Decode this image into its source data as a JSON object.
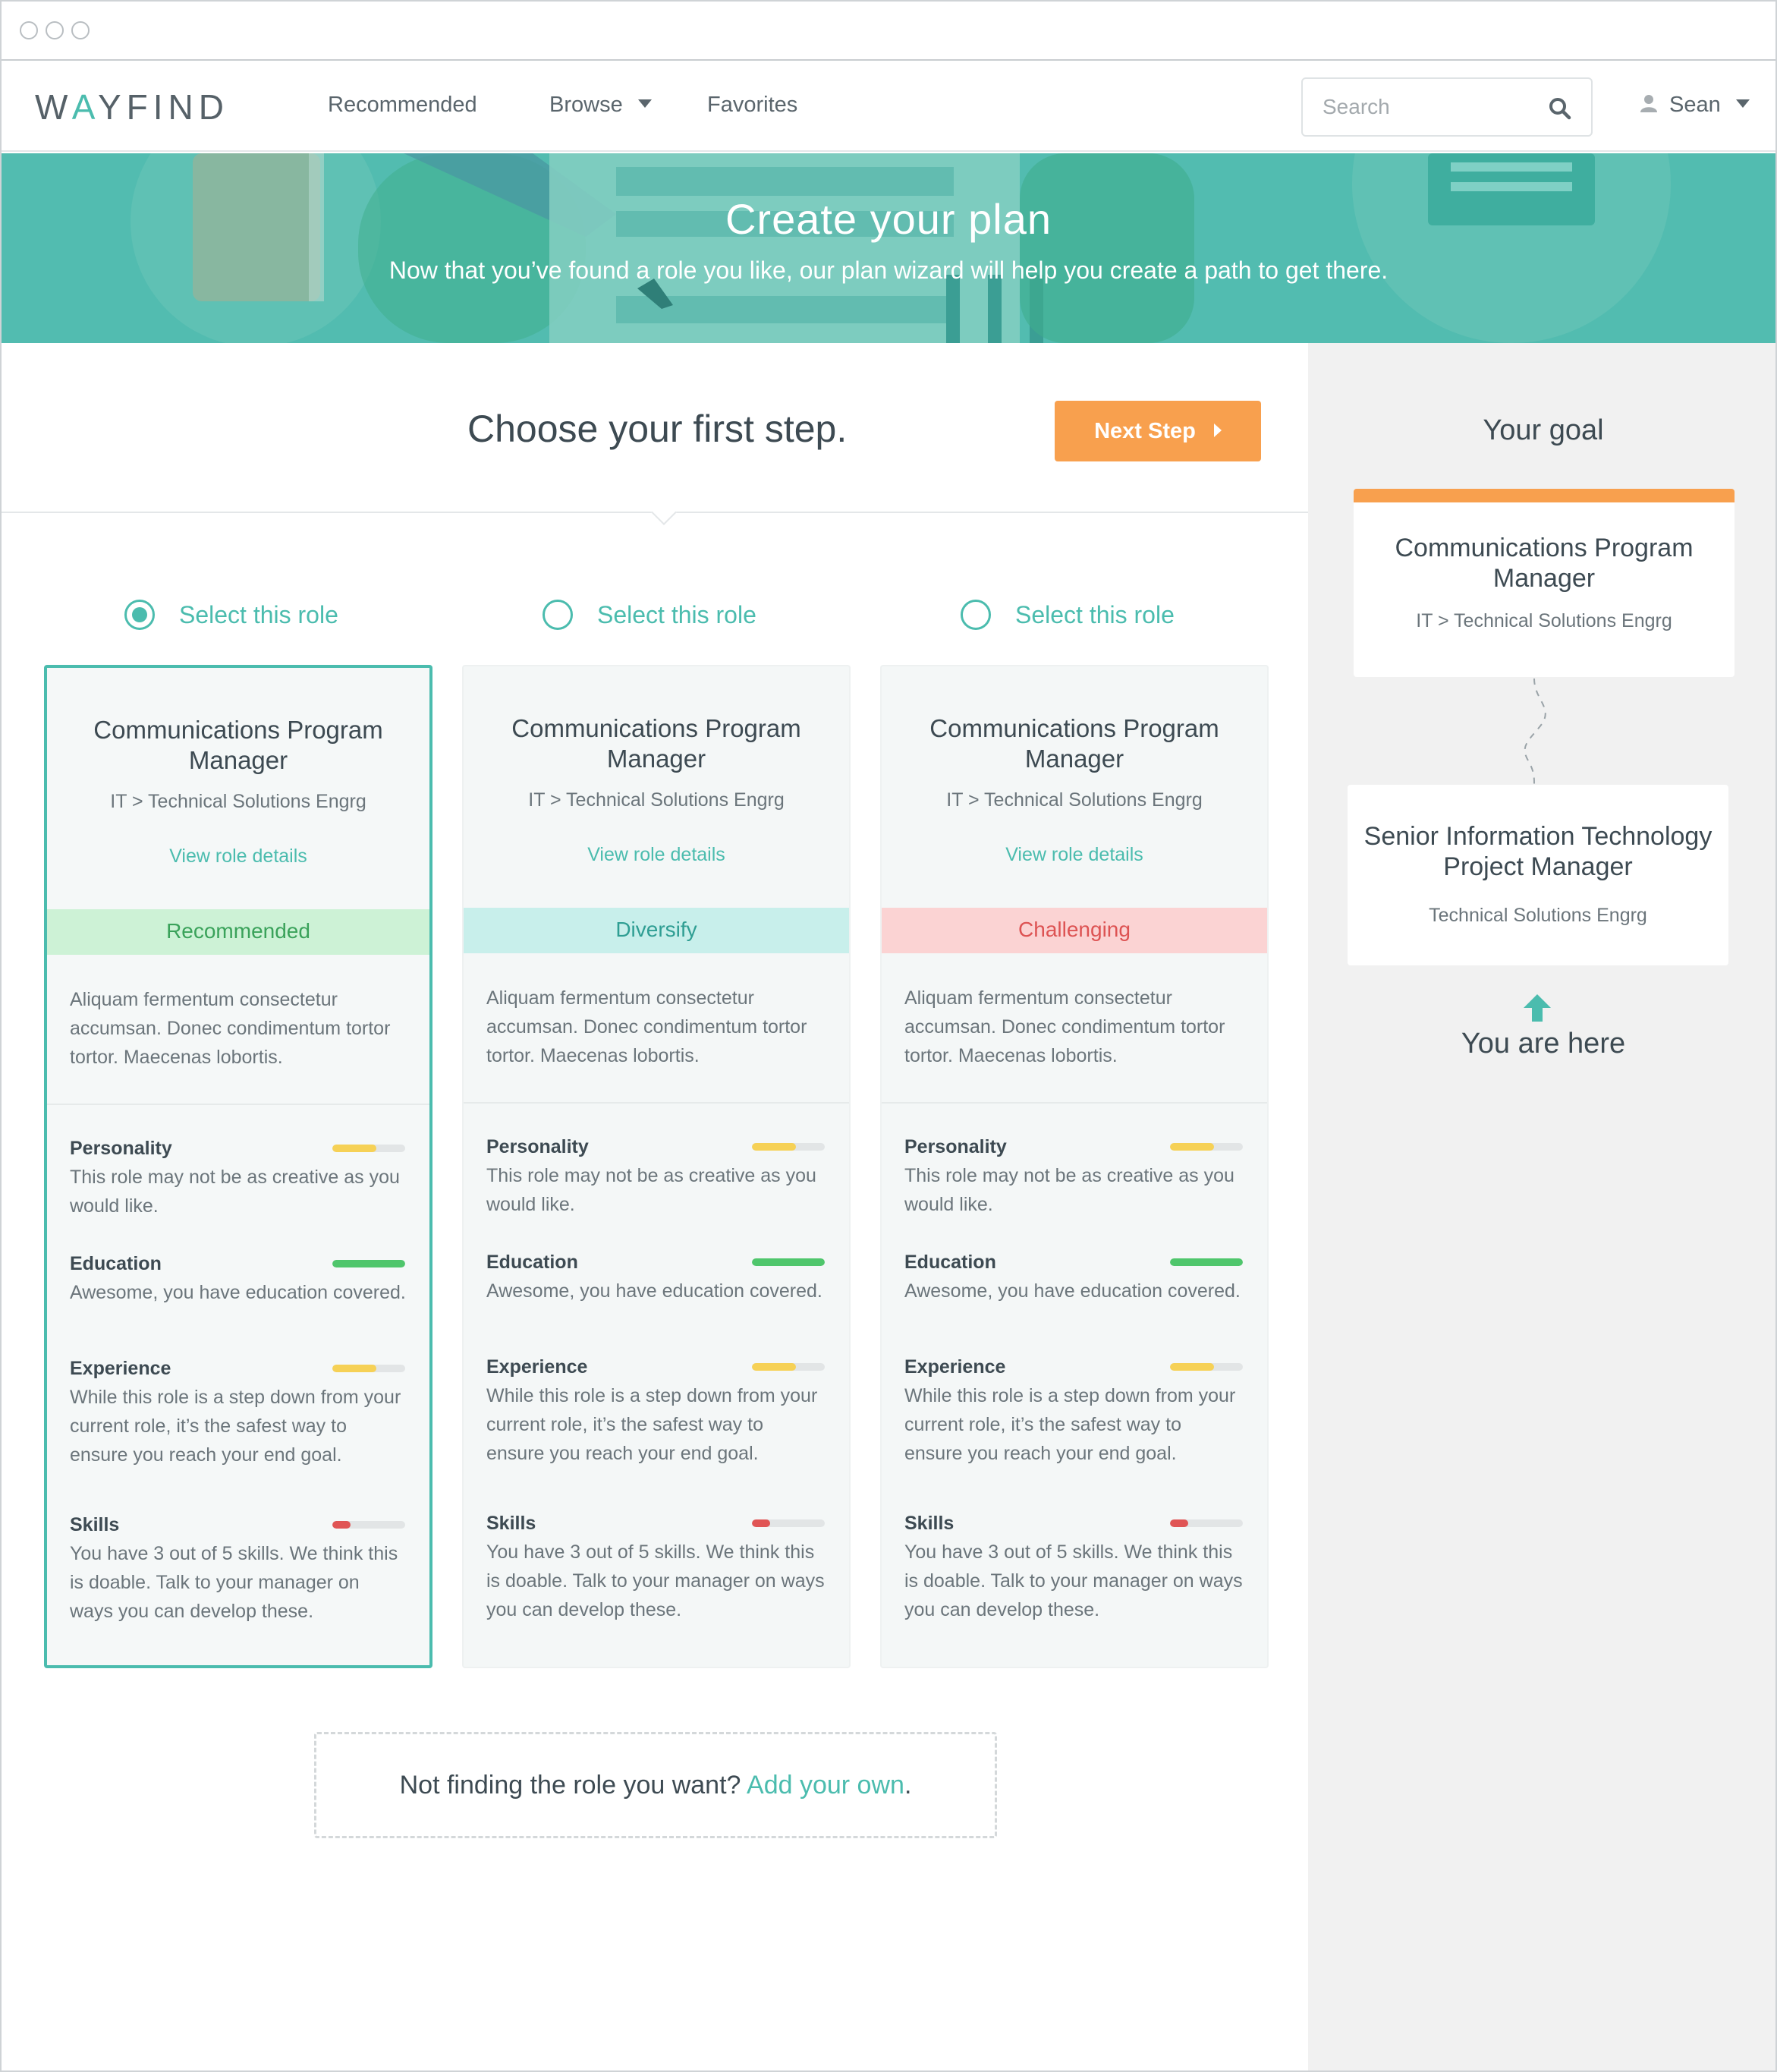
{
  "nav": {
    "logo_prefix": "W",
    "logo_accent": "A",
    "logo_suffix": "YFIND",
    "links": [
      "Recommended",
      "Browse",
      "Favorites"
    ],
    "search_placeholder": "Search",
    "user_name": "Sean"
  },
  "hero": {
    "title": "Create your plan",
    "subtitle": "Now that you’ve found a role you like, our plan wizard will help you create a path to get there."
  },
  "wizard": {
    "step_title": "Choose your first step.",
    "next_button": "Next Step"
  },
  "roles": [
    {
      "select_label": "Select this role",
      "selected": true,
      "title": "Communications Program Manager",
      "path": "IT > Technical Solutions Engrg",
      "details_link": "View role details",
      "tag": "Recommended",
      "description": "Aliquam fermentum consectetur accumsan. Donec condimentum tortor tortor. Maecenas lobortis.",
      "metrics": [
        {
          "name": "Personality",
          "text": "This role may not be as creative as you would like.",
          "level": 0.6,
          "status": "yellow"
        },
        {
          "name": "Education",
          "text": "Awesome, you have education covered.",
          "level": 1.0,
          "status": "green"
        },
        {
          "name": "Experience",
          "text": "While this role is a step down from your current role, it’s the safest way to ensure you reach your end goal.",
          "level": 0.6,
          "status": "yellow"
        },
        {
          "name": "Skills",
          "text": "You have 3 out of 5 skills. We think this is doable. Talk to your manager on ways you can develop these.",
          "level": 0.25,
          "status": "red"
        }
      ]
    },
    {
      "select_label": "Select this role",
      "selected": false,
      "title": "Communications Program Manager",
      "path": "IT > Technical Solutions Engrg",
      "details_link": "View role details",
      "tag": "Diversify",
      "description": "Aliquam fermentum consectetur accumsan. Donec condimentum tortor tortor. Maecenas lobortis.",
      "metrics": [
        {
          "name": "Personality",
          "text": "This role may not be as creative as you would like.",
          "level": 0.6,
          "status": "yellow"
        },
        {
          "name": "Education",
          "text": "Awesome, you have education covered.",
          "level": 1.0,
          "status": "green"
        },
        {
          "name": "Experience",
          "text": "While this role is a step down from your current role, it’s the safest way to ensure you reach your end goal.",
          "level": 0.6,
          "status": "yellow"
        },
        {
          "name": "Skills",
          "text": "You have 3 out of 5 skills. We think this is doable. Talk to your manager on ways you can develop these.",
          "level": 0.25,
          "status": "red"
        }
      ]
    },
    {
      "select_label": "Select this role",
      "selected": false,
      "title": "Communications Program Manager",
      "path": "IT > Technical Solutions Engrg",
      "details_link": "View role details",
      "tag": "Challenging",
      "description": "Aliquam fermentum consectetur accumsan. Donec condimentum tortor tortor. Maecenas lobortis.",
      "metrics": [
        {
          "name": "Personality",
          "text": "This role may not be as creative as you would like.",
          "level": 0.6,
          "status": "yellow"
        },
        {
          "name": "Education",
          "text": "Awesome, you have education covered.",
          "level": 1.0,
          "status": "green"
        },
        {
          "name": "Experience",
          "text": "While this role is a step down from your current role, it’s the safest way to ensure you reach your end goal.",
          "level": 0.6,
          "status": "yellow"
        },
        {
          "name": "Skills",
          "text": "You have 3 out of 5 skills. We think this is doable. Talk to your manager on ways you can develop these.",
          "level": 0.25,
          "status": "red"
        }
      ]
    }
  ],
  "add_own": {
    "prefix": "Not finding the role you want?",
    "link": "Add your own",
    "suffix": "."
  },
  "goal": {
    "label": "Your goal",
    "title": "Communications Program Manager",
    "path": "IT > Technical Solutions Engrg"
  },
  "current": {
    "title": "Senior Information Technology Project Manager",
    "path": "Technical Solutions Engrg",
    "label": "You are here"
  },
  "colors": {
    "teal": "#4bbcae",
    "orange": "#f8a04e",
    "hero": "#52bcb0"
  }
}
